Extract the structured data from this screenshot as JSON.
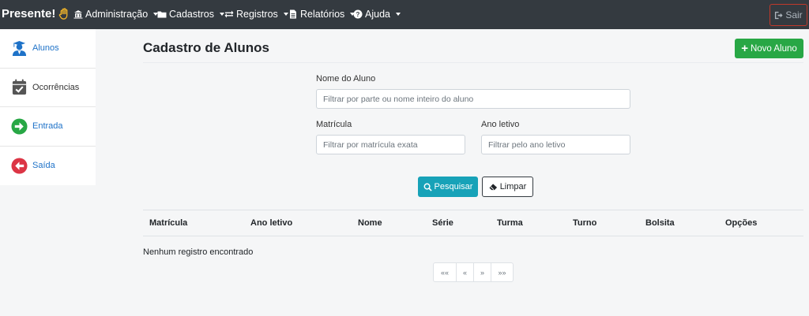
{
  "navbar": {
    "brand": "Presente!",
    "menus": [
      {
        "label": "Administração",
        "icon": "building-icon"
      },
      {
        "label": "Cadastros",
        "icon": "folder-icon"
      },
      {
        "label": "Registros",
        "icon": "exchange-icon"
      },
      {
        "label": "Relatórios",
        "icon": "file-icon"
      },
      {
        "label": "Ajuda",
        "icon": "question-circle-icon"
      }
    ],
    "logout_label": "Sair"
  },
  "sidebar": {
    "items": [
      {
        "label": "Alunos",
        "icon": "student-icon"
      },
      {
        "label": "Ocorrências",
        "icon": "calendar-check-icon"
      },
      {
        "label": "Entrada",
        "icon": "arrow-right-circle-icon"
      },
      {
        "label": "Saída",
        "icon": "arrow-left-circle-icon"
      }
    ]
  },
  "main": {
    "title": "Cadastro de Alunos",
    "new_button": "Novo Aluno",
    "filters": {
      "name": {
        "label": "Nome do Aluno",
        "placeholder": "Filtrar por parte ou nome inteiro do aluno"
      },
      "matricula": {
        "label": "Matrícula",
        "placeholder": "Filtrar por matrícula exata"
      },
      "ano": {
        "label": "Ano letivo",
        "placeholder": "Filtrar pelo ano letivo"
      }
    },
    "search_button": "Pesquisar",
    "clear_button": "Limpar",
    "table": {
      "columns": [
        "Matrícula",
        "Ano letivo",
        "Nome",
        "Série",
        "Turma",
        "Turno",
        "Bolsita",
        "Opções"
      ],
      "empty_message": "Nenhum registro encontrado"
    },
    "pagination": [
      "««",
      "«",
      "»",
      "»»"
    ]
  },
  "colors": {
    "navbar": "#343a40",
    "success": "#28a745",
    "info": "#17a2b8",
    "link": "#1e72c8",
    "danger": "#dc3545"
  }
}
